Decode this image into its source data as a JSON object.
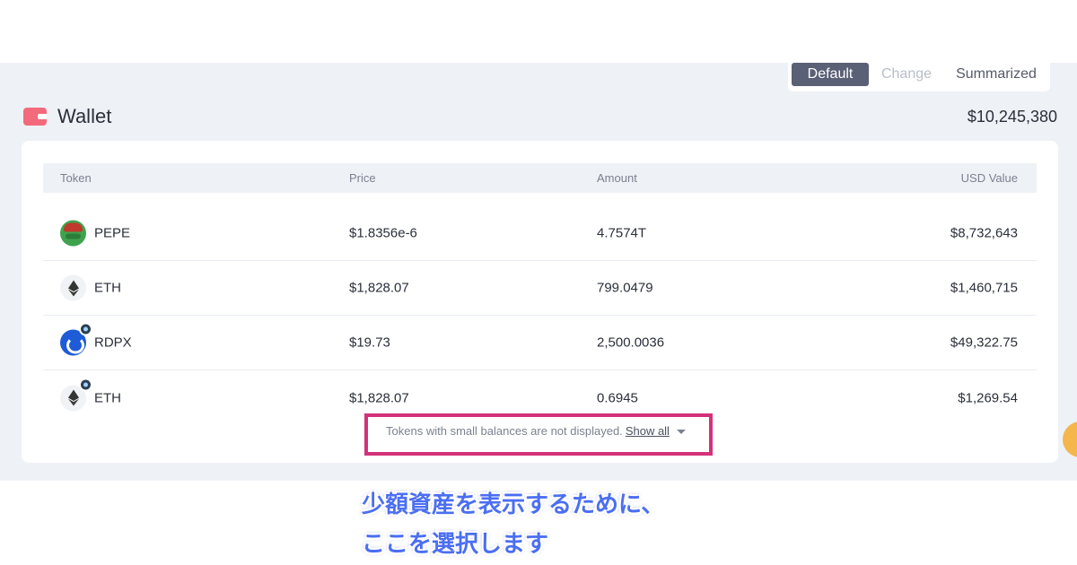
{
  "view_tabs": {
    "default": "Default",
    "change": "Change",
    "summarized": "Summarized"
  },
  "wallet": {
    "title": "Wallet",
    "total": "$10,245,380"
  },
  "table": {
    "headers": {
      "token": "Token",
      "price": "Price",
      "amount": "Amount",
      "usd_value": "USD Value"
    },
    "rows": [
      {
        "symbol": "PEPE",
        "price": "$1.8356e-6",
        "amount": "4.7574T",
        "usd_value": "$8,732,643",
        "icon": "pepe-icon"
      },
      {
        "symbol": "ETH",
        "price": "$1,828.07",
        "amount": "799.0479",
        "usd_value": "$1,460,715",
        "icon": "eth-icon"
      },
      {
        "symbol": "RDPX",
        "price": "$19.73",
        "amount": "2,500.0036",
        "usd_value": "$49,322.75",
        "icon": "rdpx-icon"
      },
      {
        "symbol": "ETH",
        "price": "$1,828.07",
        "amount": "0.6945",
        "usd_value": "$1,269.54",
        "icon": "eth-icon"
      }
    ]
  },
  "notice": {
    "text": "Tokens with small balances are not displayed.",
    "link": "Show all"
  },
  "caption": {
    "line1": "少額資産を表示するために、",
    "line2": "ここを選択します"
  },
  "colors": {
    "accent_highlight": "#d4317a",
    "caption_blue": "#4b6ef2",
    "active_tab": "#5a6075",
    "wallet_icon": "#f26a7c"
  }
}
